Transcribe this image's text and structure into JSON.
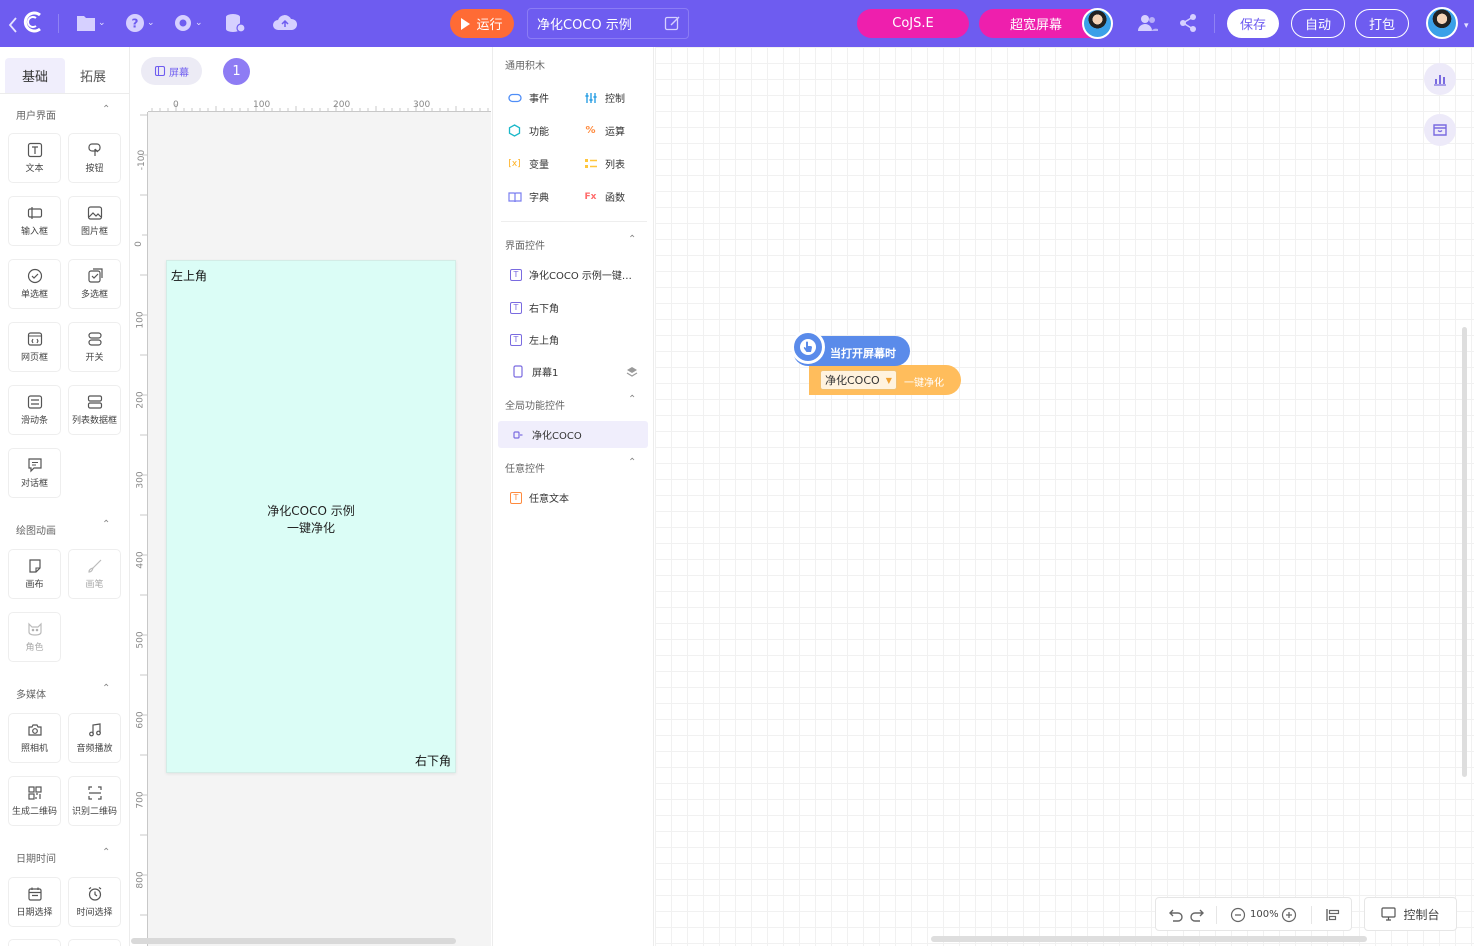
{
  "topbar": {
    "run_label": "运行",
    "project_title": "净化COCO 示例",
    "cojs_label": "CoJS.E",
    "widescreen_label": "超宽屏幕",
    "save_label": "保存",
    "auto_label": "自动",
    "package_label": "打包",
    "icons": [
      "back-icon",
      "logo-icon",
      "file-icon",
      "help-icon",
      "settings-icon",
      "database-icon",
      "cloud-icon",
      "user-group-icon",
      "share-icon"
    ],
    "accent": "#6e5cf0",
    "run_color": "#ff6b35",
    "pink": "#ee1fad"
  },
  "left_panel": {
    "tabs": [
      "基础",
      "拓展"
    ],
    "sections": [
      {
        "title": "用户界面",
        "items": [
          "文本",
          "按钮",
          "输入框",
          "图片框",
          "单选框",
          "多选框",
          "网页框",
          "开关",
          "滑动条",
          "列表数据框",
          "对话框"
        ]
      },
      {
        "title": "绘图动画",
        "items": [
          "画布",
          "画笔",
          "角色"
        ]
      },
      {
        "title": "多媒体",
        "items": [
          "照相机",
          "音频播放",
          "生成二维码",
          "识别二维码"
        ]
      },
      {
        "title": "日期时间",
        "items": [
          "日期选择",
          "时间选择"
        ]
      }
    ]
  },
  "design": {
    "screen_chip": "屏幕",
    "screen_num": "1",
    "ruler_x": [
      "0",
      "100",
      "200",
      "300"
    ],
    "ruler_y": [
      "-100",
      "0",
      "100",
      "200",
      "300",
      "400",
      "500",
      "600",
      "700",
      "800"
    ],
    "phone": {
      "top_left": "左上角",
      "bottom_right": "右下角",
      "center_line1": "净化COCO 示例",
      "center_line2": "一键净化",
      "bg": "#dbfdf6"
    }
  },
  "blocks_panel": {
    "general_title": "通用积木",
    "categories": [
      {
        "label": "事件",
        "color": "#4f8ef7"
      },
      {
        "label": "控制",
        "color": "#38a6e6"
      },
      {
        "label": "功能",
        "color": "#1bb8c9"
      },
      {
        "label": "运算",
        "color": "#ff8a3d"
      },
      {
        "label": "变量",
        "color": "#ffb020"
      },
      {
        "label": "列表",
        "color": "#ffc63b"
      },
      {
        "label": "字典",
        "color": "#7a7ef0"
      },
      {
        "label": "函数",
        "color": "#ff6b6b"
      }
    ],
    "ui_controls_title": "界面控件",
    "ui_controls": [
      "净化COCO 示例一键…",
      "右下角",
      "左上角",
      "屏幕1"
    ],
    "global_title": "全局功能控件",
    "global_controls": [
      "净化COCO"
    ],
    "any_title": "任意控件",
    "any_controls": [
      "任意文本"
    ]
  },
  "workspace": {
    "event_block": "当打开屏幕时",
    "action_dropdown": "净化COCO",
    "action_text": "一键净化",
    "zoom": "100%",
    "console_label": "控制台"
  }
}
